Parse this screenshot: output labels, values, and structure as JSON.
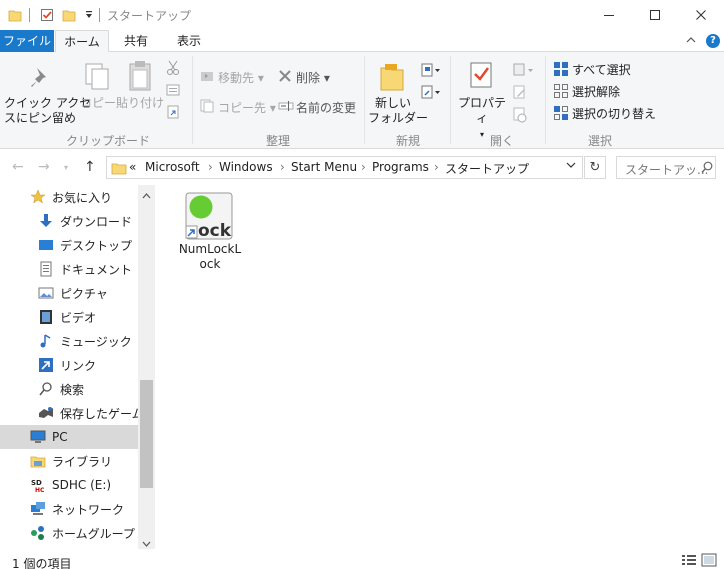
{
  "window": {
    "title": "スタートアップ",
    "minimize": "—",
    "maximize": "☐",
    "close": "✕"
  },
  "tabs": [
    {
      "label": "ファイル"
    },
    {
      "label": "ホーム"
    },
    {
      "label": "共有"
    },
    {
      "label": "表示"
    }
  ],
  "ribbon": {
    "clipboard": {
      "pin_label": "クイック アクセ\nスにピン留め",
      "copy_label": "コピー",
      "paste_label": "貼り付け",
      "group_label": "クリップボード"
    },
    "organize": {
      "move_label": "移動先",
      "copy_to_label": "コピー先",
      "delete_label": "削除",
      "rename_label": "名前の変更",
      "group_label": "整理"
    },
    "new": {
      "new_folder_label": "新しい\nフォルダー",
      "group_label": "新規"
    },
    "open": {
      "properties_label": "プロパティ",
      "group_label": "開く"
    },
    "select": {
      "select_all_label": "すべて選択",
      "select_none_label": "選択解除",
      "invert_label": "選択の切り替え",
      "group_label": "選択"
    }
  },
  "address": {
    "overflow": "«",
    "crumbs": [
      "Microsoft",
      "Windows",
      "Start Menu",
      "Programs",
      "スタートアップ"
    ],
    "search_placeholder": "スタートアッ..."
  },
  "nav_pane": {
    "items": [
      {
        "label": "お気に入り"
      },
      {
        "label": "ダウンロード"
      },
      {
        "label": "デスクトップ"
      },
      {
        "label": "ドキュメント"
      },
      {
        "label": "ピクチャ"
      },
      {
        "label": "ビデオ"
      },
      {
        "label": "ミュージック"
      },
      {
        "label": "リンク"
      },
      {
        "label": "検索"
      },
      {
        "label": "保存したゲーム"
      },
      {
        "label": "PC"
      },
      {
        "label": "ライブラリ"
      },
      {
        "label": "SDHC (E:)"
      },
      {
        "label": "ネットワーク"
      },
      {
        "label": "ホームグループ"
      }
    ]
  },
  "files": [
    {
      "name": "NumLockLock",
      "icon_text": "ock"
    }
  ],
  "status": {
    "item_count": "1 個の項目"
  },
  "colors": {
    "accent": "#1979ca",
    "folder": "#f8d775",
    "selection": "#d9d9d9"
  }
}
